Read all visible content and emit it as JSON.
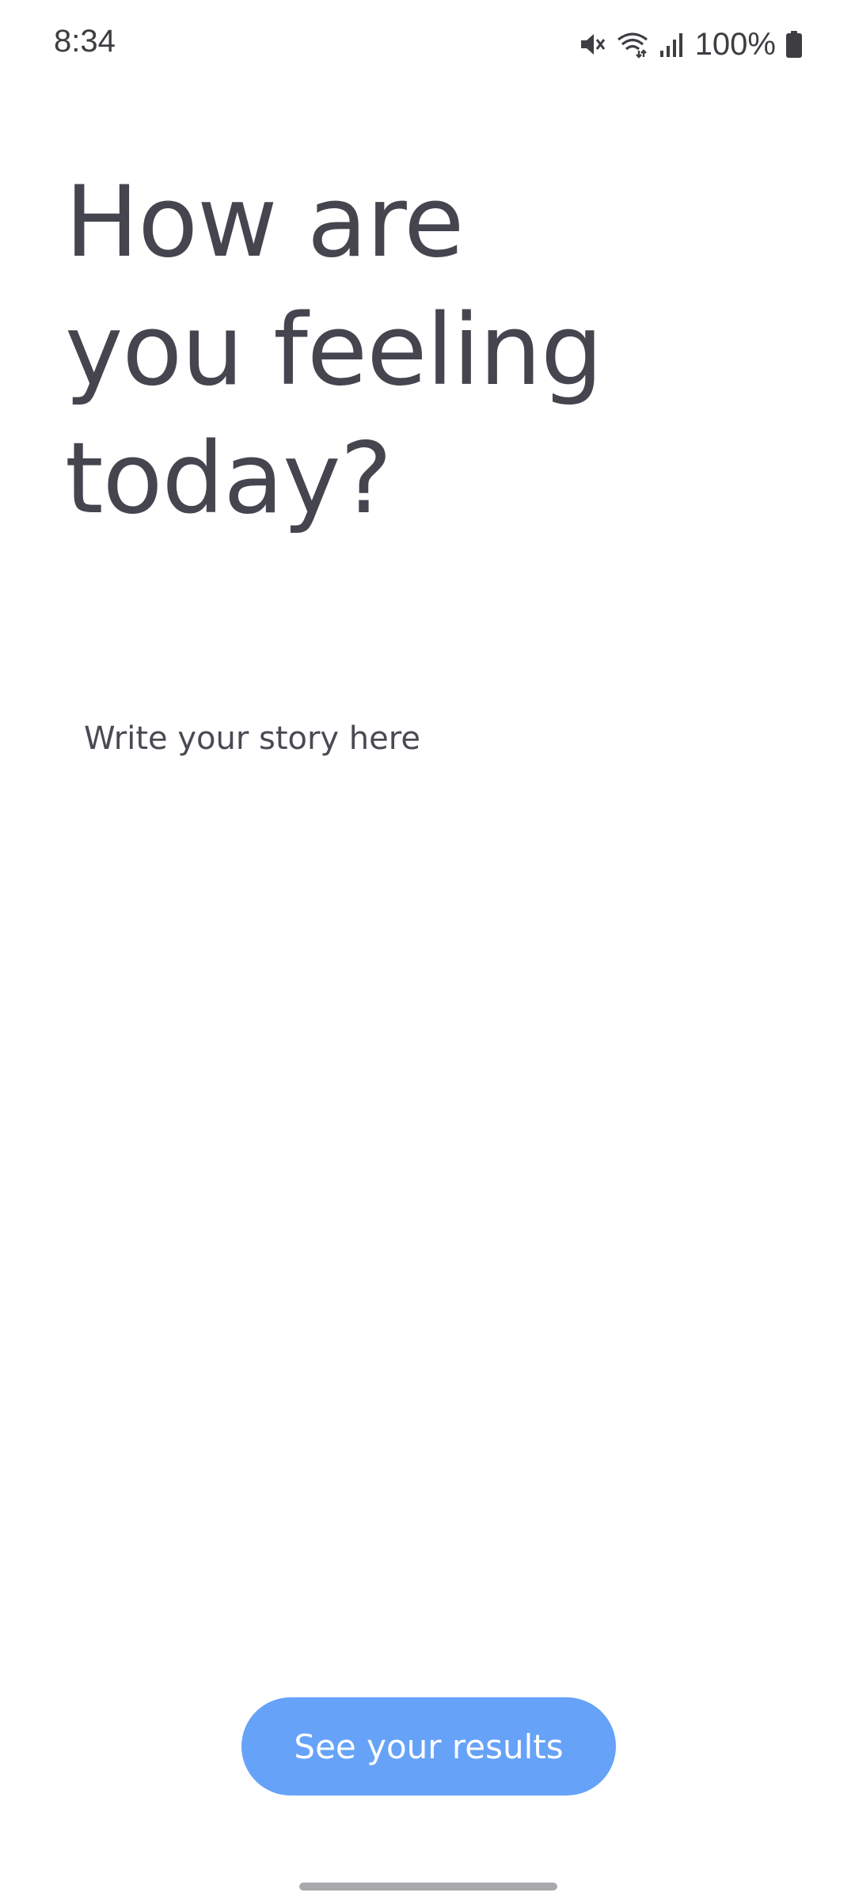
{
  "status_bar": {
    "time": "8:34",
    "battery_percent": "100%",
    "icons": [
      "mute-icon",
      "wifi-icon",
      "signal-icon",
      "battery-icon"
    ]
  },
  "title": {
    "line1": "How are",
    "line2": "you feeling",
    "line3": "today?"
  },
  "story": {
    "placeholder": "Write your story here",
    "value": ""
  },
  "results_button": {
    "label": "See your results"
  },
  "colors": {
    "accent": "#66a3f8",
    "text": "#45454f",
    "background": "#ffffff"
  }
}
